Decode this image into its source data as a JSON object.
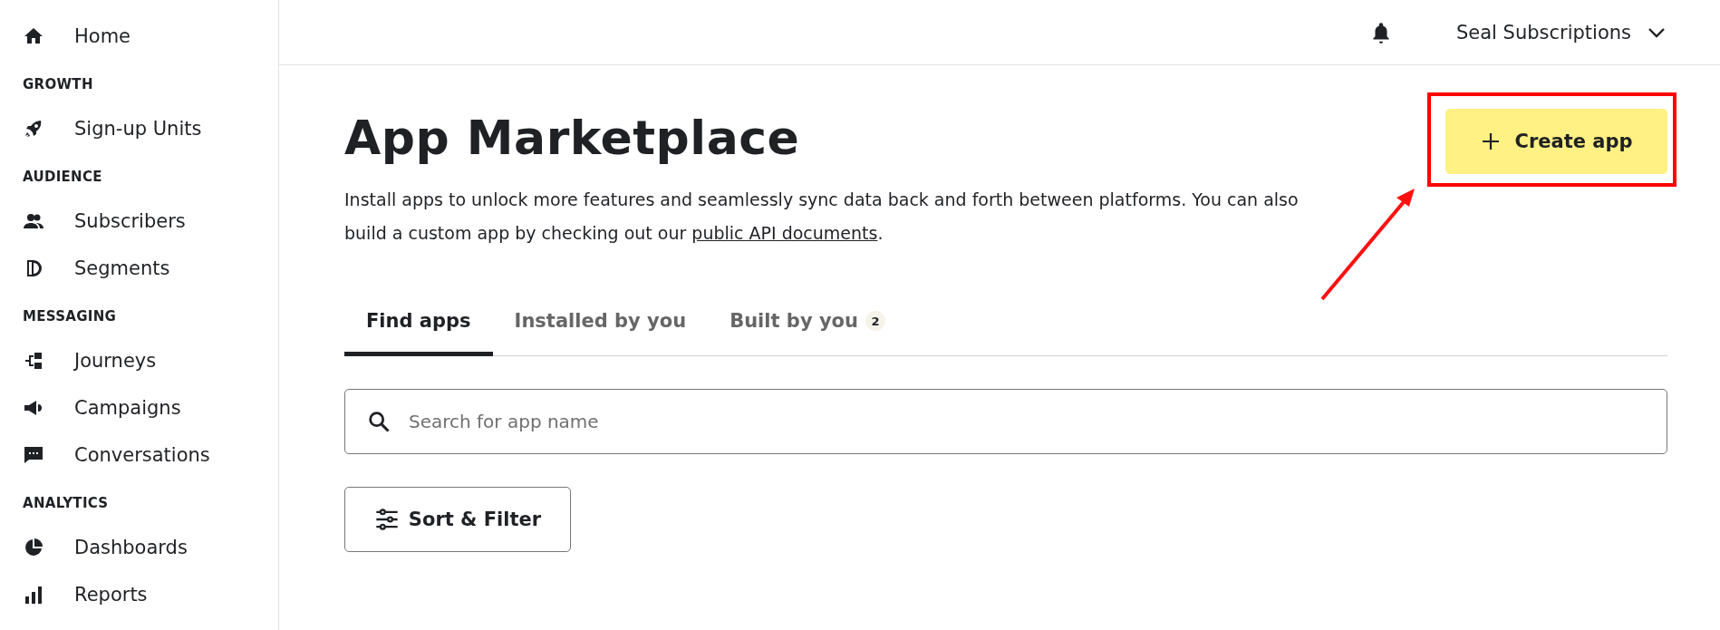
{
  "sidebar": {
    "home": {
      "label": "Home"
    },
    "sections": [
      {
        "heading": "GROWTH",
        "items": [
          {
            "label": "Sign-up Units"
          }
        ]
      },
      {
        "heading": "AUDIENCE",
        "items": [
          {
            "label": "Subscribers"
          },
          {
            "label": "Segments"
          }
        ]
      },
      {
        "heading": "MESSAGING",
        "items": [
          {
            "label": "Journeys"
          },
          {
            "label": "Campaigns"
          },
          {
            "label": "Conversations"
          }
        ]
      },
      {
        "heading": "ANALYTICS",
        "items": [
          {
            "label": "Dashboards"
          },
          {
            "label": "Reports"
          }
        ]
      }
    ]
  },
  "topbar": {
    "account": "Seal Subscriptions"
  },
  "page": {
    "title": "App Marketplace",
    "create_button": "Create app",
    "description": "Install apps to unlock more features and seamlessly sync data back and forth between platforms. You can also build a custom app by checking out our ",
    "description_link": "public API documents",
    "description_end": ".",
    "tabs": [
      {
        "label": "Find apps",
        "selected": true
      },
      {
        "label": "Installed by you",
        "selected": false
      },
      {
        "label": "Built by you",
        "selected": false,
        "count": "2"
      }
    ],
    "search": {
      "placeholder": "Search for app name"
    },
    "sort_button": "Sort & Filter"
  }
}
